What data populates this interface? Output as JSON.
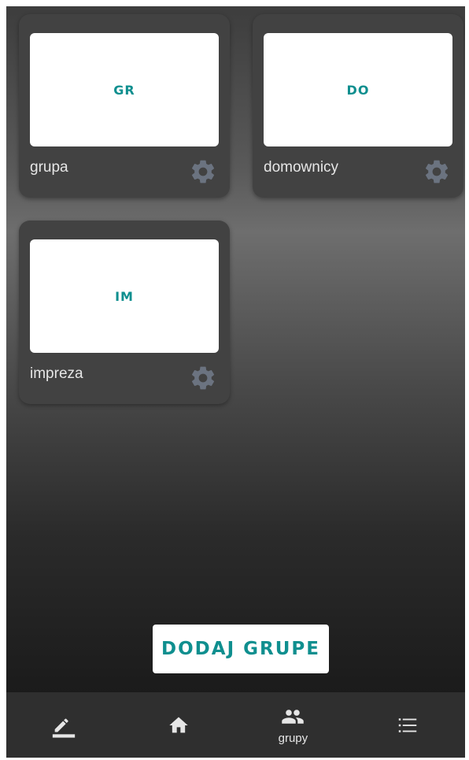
{
  "groups": [
    {
      "initials": "GR",
      "name": "grupa"
    },
    {
      "initials": "DO",
      "name": "domownicy"
    },
    {
      "initials": "IM",
      "name": "impreza"
    }
  ],
  "icons": {
    "card_settings": "gear-icon",
    "nav": [
      "pencil-icon",
      "home-icon",
      "people-icon",
      "list-icon"
    ]
  },
  "add_button": {
    "label": "DODAJ GRUPE"
  },
  "bottom_nav": {
    "items": [
      {
        "icon": "pencil-icon",
        "label": ""
      },
      {
        "icon": "home-icon",
        "label": ""
      },
      {
        "icon": "people-icon",
        "label": "grupy",
        "active": true
      },
      {
        "icon": "list-icon",
        "label": ""
      }
    ]
  },
  "colors": {
    "accent": "#0f8f8f",
    "card_bg": "#424242",
    "gear": "#6b7380",
    "nav_bg": "#2f2f2f",
    "nav_icon": "#e6e6e6"
  }
}
